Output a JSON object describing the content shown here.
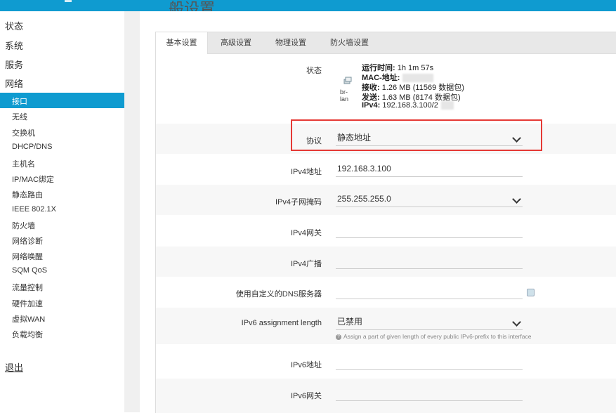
{
  "page": {
    "heading": "般设置"
  },
  "sidebar": {
    "top_items": [
      "状态",
      "系统",
      "服务",
      "网络"
    ],
    "network_items": [
      "接口",
      "无线",
      "交换机",
      "DHCP/DNS",
      "主机名",
      "IP/MAC绑定",
      "静态路由",
      "IEEE 802.1X",
      "防火墙",
      "网络诊断",
      "网络唤醒",
      "SQM QoS",
      "流量控制",
      "硬件加速",
      "虚拟WAN",
      "负载均衡"
    ],
    "logout": "退出"
  },
  "tabs": [
    "基本设置",
    "高级设置",
    "物理设置",
    "防火墙设置"
  ],
  "status": {
    "label": "状态",
    "device": "br-lan",
    "uptime_label": "运行时间:",
    "uptime_value": "1h 1m 57s",
    "mac_label": "MAC-地址:",
    "rx_label": "接收:",
    "rx_value": "1.26 MB (11569 数据包)",
    "tx_label": "发送:",
    "tx_value": "1.63 MB (8174 数据包)",
    "ipv4_label": "IPv4:",
    "ipv4_value": "192.168.3.100/2"
  },
  "form": {
    "protocol_label": "协议",
    "protocol_value": "静态地址",
    "ipv4_addr_label": "IPv4地址",
    "ipv4_addr_value": "192.168.3.100",
    "ipv4_mask_label": "IPv4子网掩码",
    "ipv4_mask_value": "255.255.255.0",
    "ipv4_gw_label": "IPv4网关",
    "ipv4_bcast_label": "IPv4广播",
    "dns_label": "使用自定义的DNS服务器",
    "ipv6_assign_label": "IPv6 assignment length",
    "ipv6_assign_value": "已禁用",
    "ipv6_assign_hint": "Assign a part of given length of every public IPv6-prefix to this interface",
    "ipv6_addr_label": "IPv6地址",
    "ipv6_gw_label": "IPv6网关"
  },
  "colors": {
    "accent": "#0f9bd0",
    "highlight": "#e53935"
  }
}
